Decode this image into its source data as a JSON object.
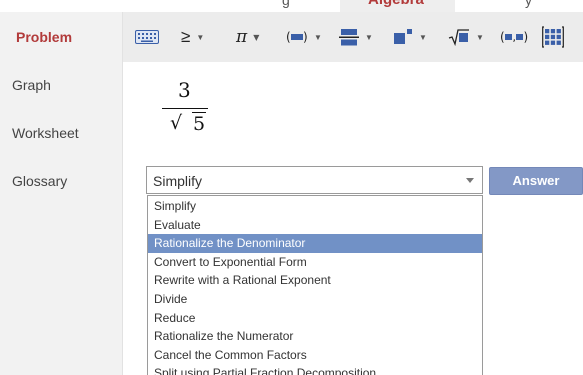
{
  "top_tabs": {
    "left_fragment": "g",
    "active": "Algebra",
    "right_fragment": "y"
  },
  "sidebar": {
    "items": [
      {
        "label": "Problem",
        "active": true
      },
      {
        "label": "Graph",
        "active": false
      },
      {
        "label": "Worksheet",
        "active": false
      },
      {
        "label": "Glossary",
        "active": false
      }
    ]
  },
  "toolbar": {
    "tools": [
      {
        "icon": "keyboard-icon"
      },
      {
        "icon": "greater-equal-icon",
        "glyph": "≥"
      },
      {
        "icon": "pi-icon",
        "glyph": "π"
      },
      {
        "icon": "parentheses-icon",
        "glyph": "(▬)"
      },
      {
        "icon": "fraction-icon"
      },
      {
        "icon": "exponent-icon"
      },
      {
        "icon": "square-root-icon",
        "glyph": "√"
      },
      {
        "icon": "ordered-pair-icon",
        "glyph": "(▪,▪)"
      },
      {
        "icon": "matrix-icon"
      }
    ]
  },
  "problem": {
    "numerator": "3",
    "radical": "√",
    "radicand": "5"
  },
  "select": {
    "value": "Simplify",
    "options": [
      "Simplify",
      "Evaluate",
      "Rationalize the Denominator",
      "Convert to Exponential Form",
      "Rewrite with a Rational Exponent",
      "Divide",
      "Reduce",
      "Rationalize the Numerator",
      "Cancel the Common Factors",
      "Split using Partial Fraction Decomposition"
    ],
    "highlighted": "Rationalize the Denominator"
  },
  "answer_button": {
    "label": "Answer"
  },
  "colors": {
    "accent_red": "#b23b3b",
    "button_blue": "#8398c6",
    "highlight_blue": "#7191c6",
    "toolbar_blue": "#3a5fa8"
  }
}
